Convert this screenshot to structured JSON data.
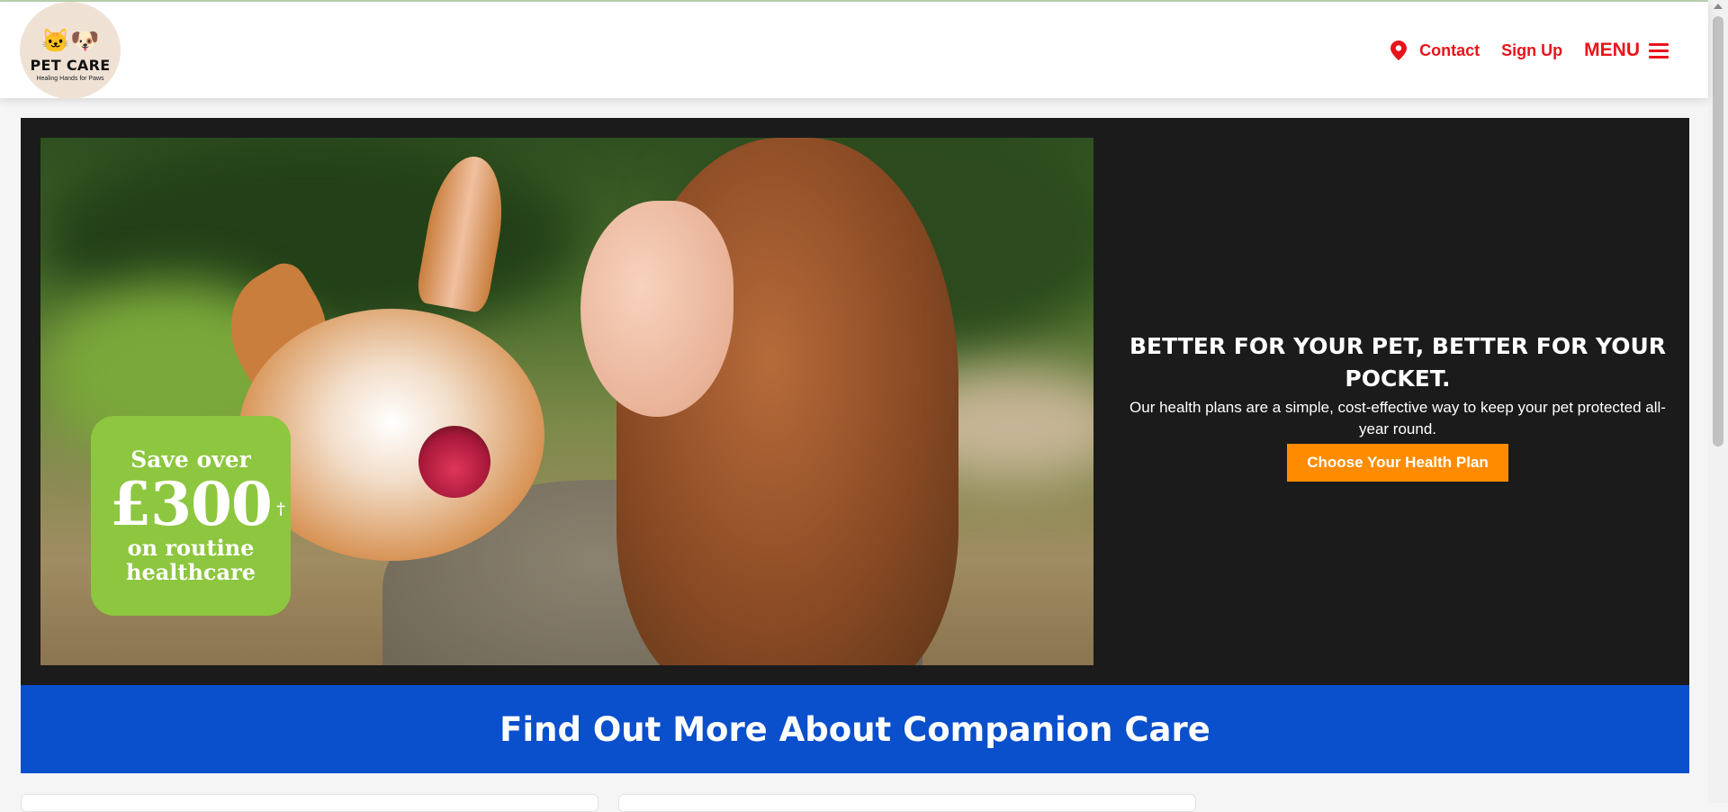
{
  "header": {
    "logo": {
      "name": "PET CARE",
      "tagline": "Healing Hands for Paws",
      "pets": "🐱🐶"
    },
    "nav": {
      "contact_label": "Contact",
      "contact_icon": "map-pin-icon",
      "signup_label": "Sign Up",
      "menu_label": "MENU",
      "menu_icon": "hamburger-icon"
    }
  },
  "hero": {
    "badge": {
      "save_label": "Save over",
      "amount": "£300",
      "dagger": "†",
      "routine_label": "on routine",
      "healthcare_label": "healthcare"
    },
    "title": "BETTER FOR YOUR PET, BETTER FOR YOUR POCKET.",
    "description": "Our health plans are a simple, cost-effective way to keep your pet protected all-year round.",
    "cta_label": "Choose Your Health Plan"
  },
  "banner": {
    "title": "Find Out More About Companion Care"
  },
  "colors": {
    "accent_red": "#e8141b",
    "cta_orange": "#ff8c00",
    "banner_blue": "#0a4fcb",
    "badge_green": "#8dc63f",
    "hero_bg": "#1b1b1b"
  }
}
